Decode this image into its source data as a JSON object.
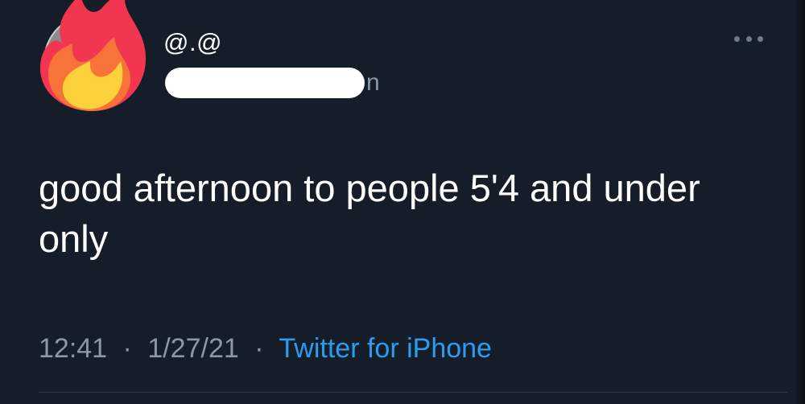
{
  "tweet": {
    "author": {
      "display_name": "@.@",
      "handle_visible_fragment": "n",
      "avatar_icon": "fire-icon"
    },
    "text": "good afternoon to people 5'4 and under only",
    "time": "12:41",
    "date": "1/27/21",
    "separator": "·",
    "source": "Twitter for iPhone"
  },
  "colors": {
    "background": "#151d29",
    "text_primary": "#ffffff",
    "text_secondary": "#8b98a5",
    "link": "#2a9df0"
  }
}
